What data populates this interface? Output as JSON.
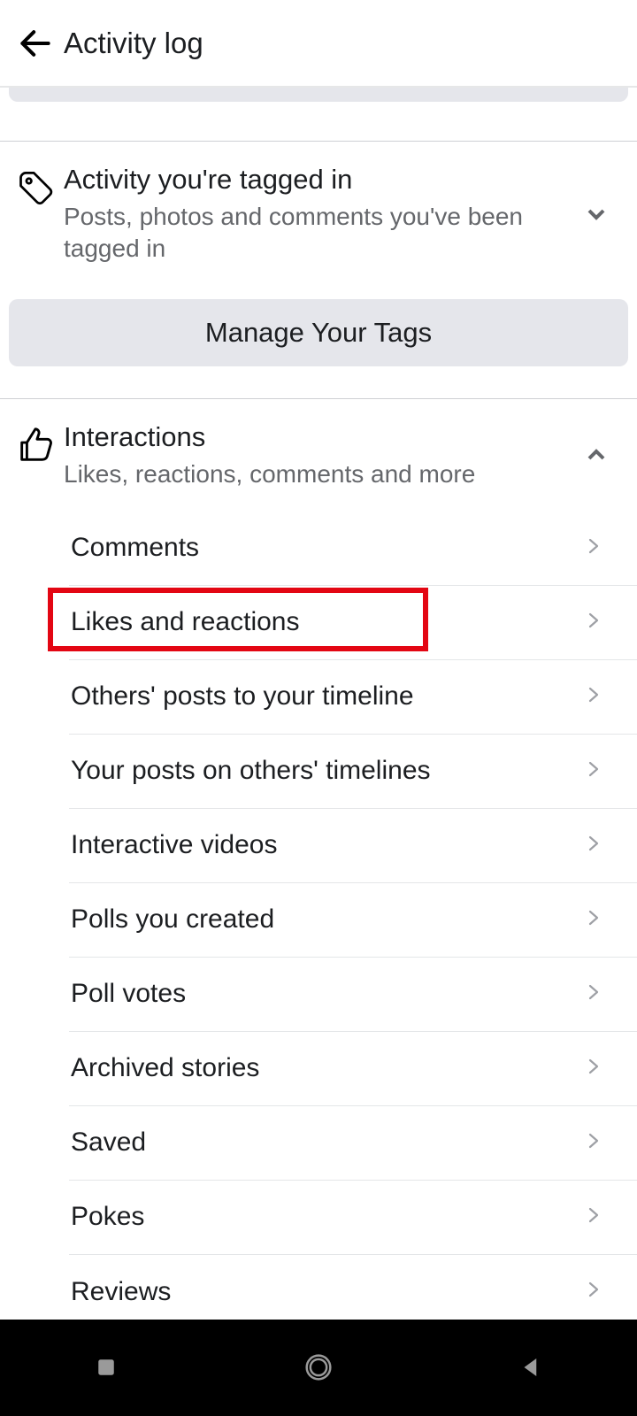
{
  "header": {
    "title": "Activity log"
  },
  "sections": {
    "tagged": {
      "title": "Activity you're tagged in",
      "desc": "Posts, photos and comments you've been tagged in",
      "button": "Manage Your Tags"
    },
    "interactions": {
      "title": "Interactions",
      "desc": "Likes, reactions, comments and more",
      "items": [
        "Comments",
        "Likes and reactions",
        "Others' posts to your timeline",
        "Your posts on others' timelines",
        "Interactive videos",
        "Polls you created",
        "Poll votes",
        "Archived stories",
        "Saved",
        "Pokes",
        "Reviews"
      ]
    }
  },
  "highlighted_item_index": 1
}
